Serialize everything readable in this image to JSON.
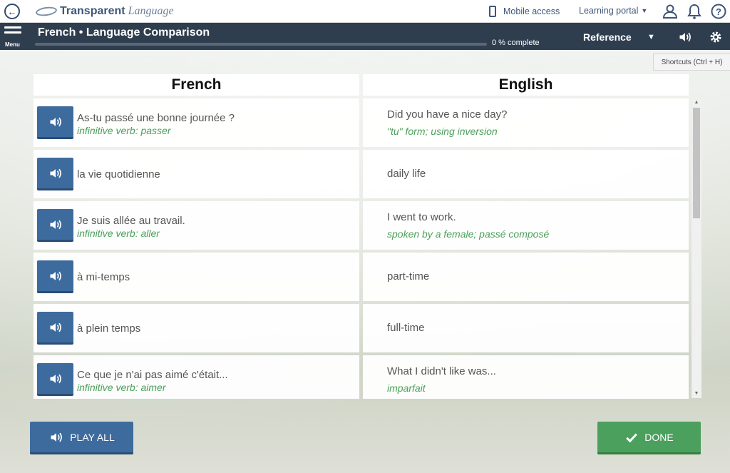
{
  "app": {
    "logo_bold": "Transparent",
    "logo_italic": "Language",
    "mobile_access": "Mobile access",
    "learning_portal": "Learning portal"
  },
  "lesson": {
    "menu_label": "Menu",
    "title": "French • Language Comparison",
    "progress_percent": 0,
    "progress_text": "0 % complete",
    "reference_label": "Reference"
  },
  "shortcuts": "Shortcuts (Ctrl + H)",
  "columns": {
    "left": "French",
    "right": "English"
  },
  "rows": [
    {
      "fr": "As-tu passé une bonne journée ?",
      "fr_note": "infinitive verb: passer",
      "en": "Did you have a nice day?",
      "en_note": "\"tu\" form; using inversion"
    },
    {
      "fr": "la vie quotidienne",
      "fr_note": "",
      "en": "daily life",
      "en_note": ""
    },
    {
      "fr": "Je suis allée au travail.",
      "fr_note": "infinitive verb: aller",
      "en": "I went to work.",
      "en_note": "spoken by a female; passé composé"
    },
    {
      "fr": "à mi-temps",
      "fr_note": "",
      "en": "part-time",
      "en_note": ""
    },
    {
      "fr": "à plein temps",
      "fr_note": "",
      "en": "full-time",
      "en_note": ""
    },
    {
      "fr": "Ce que je n'ai pas aimé c'était...",
      "fr_note": "infinitive verb: aimer",
      "en": "What I didn't like was...",
      "en_note": "imparfait"
    }
  ],
  "buttons": {
    "play_all": "PLAY ALL",
    "done": "DONE"
  },
  "colors": {
    "header_bg": "#2f3e4f",
    "speaker_button": "#3d6b9e",
    "done_button": "#4ba05d",
    "note_green": "#4aa05a"
  }
}
